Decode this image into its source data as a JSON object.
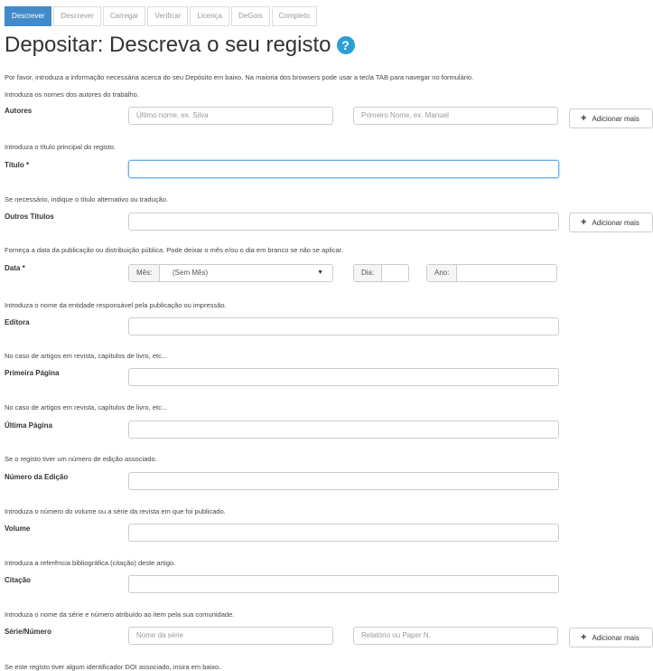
{
  "tabs": [
    "Descrever",
    "Descrever",
    "Carregar",
    "Verificar",
    "Licença",
    "DeGois",
    "Completo"
  ],
  "title": "Depositar: Descreva o seu registo",
  "help_glyph": "?",
  "intro": "Por favor, introduza a informação necessária acerca do seu Depósito em baixo. Na maioria dos browsers pode usar a tecla TAB para navegar no formulário.",
  "add_more": "Adicionar mais",
  "fields": {
    "autores": {
      "hint": "Introduza os nomes dos autores do trabalho.",
      "label": "Autores",
      "last_placeholder": "Último nome, ex. Silva",
      "first_placeholder": "Primeiro Nome, ex. Manuel"
    },
    "titulo": {
      "hint": "Introduza o título principal do registo.",
      "label": "Título *"
    },
    "outros": {
      "hint": "Se necessário, indique o título alternativo ou tradução.",
      "label": "Outros Títulos"
    },
    "data": {
      "hint": "Forneça a data da publicação ou distribuição pública. Pode deixar o mês e/ou o dia em branco se não se aplicar.",
      "label": "Data *",
      "month_label": "Mês:",
      "month_value": "(Sem Mês)",
      "day_label": "Dia:",
      "year_label": "Ano:"
    },
    "editora": {
      "hint": "Introduza o nome da entidade responsável pela publicação ou impressão.",
      "label": "Editora"
    },
    "primeira": {
      "hint": "No caso de artigos em revista, capítulos de livro, etc...",
      "label": "Primeira Página"
    },
    "ultima": {
      "hint": "No caso de artigos em revista, capítulos de livro, etc...",
      "label": "Última Página"
    },
    "edicao": {
      "hint": "Se o registo tiver um número de edição associado.",
      "label": "Número da Edição"
    },
    "volume": {
      "hint": "Introduza o número do volume ou a série da revista em que foi publicado.",
      "label": "Volume"
    },
    "citacao": {
      "hint": "Introduza a referência bibliográfica (citação) deste artigo.",
      "label": "Citação"
    },
    "serie": {
      "hint": "Introduza o nome da série e número atribuído ao item pela sua comunidade.",
      "label": "Série/Número",
      "name_placeholder": "Nome da série",
      "number_placeholder": "Relatório ou Paper N."
    },
    "doi": {
      "hint": "Se este registo tiver algum identificador DOI associado, insira em baixo."
    }
  },
  "colors": {
    "active_tab": "#428bca",
    "help_icon": "#2a9fd6",
    "focus_border": "#66afe9"
  }
}
